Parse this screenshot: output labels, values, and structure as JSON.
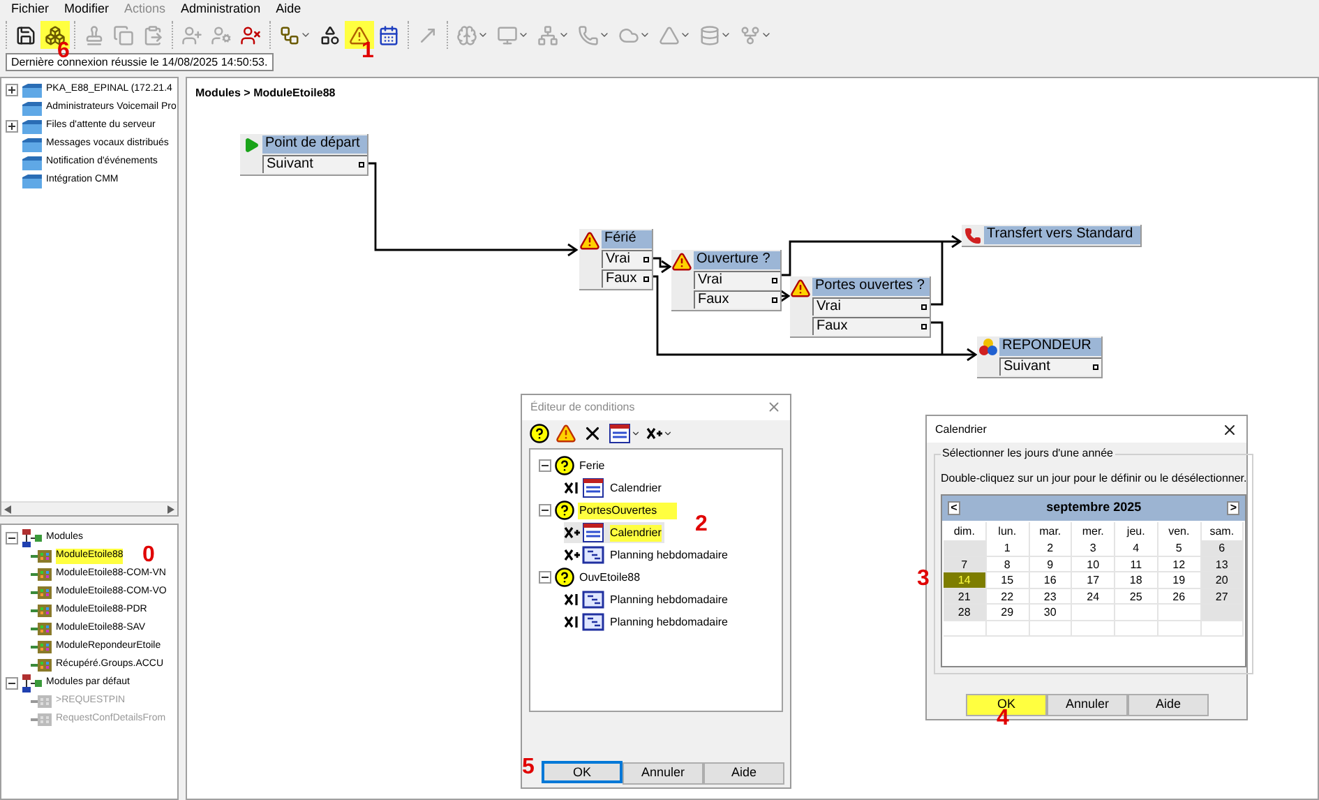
{
  "menu": [
    {
      "label": "Fichier",
      "disabled": false
    },
    {
      "label": "Modifier",
      "disabled": false
    },
    {
      "label": "Actions",
      "disabled": true
    },
    {
      "label": "Administration",
      "disabled": false
    },
    {
      "label": "Aide",
      "disabled": false
    }
  ],
  "toolbar": [
    [
      {
        "kind": "save",
        "disabled": false,
        "dropdown": false,
        "highlighted": false
      },
      {
        "kind": "module",
        "disabled": false,
        "dropdown": false,
        "highlighted": true,
        "annotation": "6"
      }
    ],
    [
      {
        "kind": "stamp",
        "disabled": true,
        "dropdown": false,
        "highlighted": false
      },
      {
        "kind": "copy",
        "disabled": true,
        "dropdown": false,
        "highlighted": false
      },
      {
        "kind": "paste",
        "disabled": true,
        "dropdown": false,
        "highlighted": false
      }
    ],
    [
      {
        "kind": "user-add",
        "disabled": true,
        "dropdown": false,
        "highlighted": false
      },
      {
        "kind": "user-help",
        "disabled": true,
        "dropdown": false,
        "highlighted": false
      },
      {
        "kind": "user-delete",
        "disabled": false,
        "dropdown": false,
        "highlighted": false
      }
    ],
    [
      {
        "kind": "connector",
        "disabled": false,
        "dropdown": true,
        "highlighted": false
      },
      {
        "kind": "shapes",
        "disabled": false,
        "dropdown": false,
        "highlighted": false
      },
      {
        "kind": "warning",
        "disabled": false,
        "dropdown": false,
        "highlighted": true,
        "annotation": "1"
      },
      {
        "kind": "calendar",
        "disabled": false,
        "dropdown": false,
        "highlighted": false
      }
    ],
    [
      {
        "kind": "line",
        "disabled": true,
        "dropdown": false,
        "highlighted": false
      }
    ],
    [
      {
        "kind": "brain",
        "disabled": true,
        "dropdown": true,
        "highlighted": false
      },
      {
        "kind": "monitor",
        "disabled": true,
        "dropdown": true,
        "highlighted": false
      },
      {
        "kind": "network",
        "disabled": true,
        "dropdown": true,
        "highlighted": false
      },
      {
        "kind": "phone",
        "disabled": true,
        "dropdown": true,
        "highlighted": false
      },
      {
        "kind": "cloud",
        "disabled": true,
        "dropdown": true,
        "highlighted": false
      },
      {
        "kind": "triangle",
        "disabled": true,
        "dropdown": true,
        "highlighted": false
      },
      {
        "kind": "disk",
        "disabled": true,
        "dropdown": true,
        "highlighted": false
      },
      {
        "kind": "fork",
        "disabled": true,
        "dropdown": true,
        "highlighted": false
      }
    ]
  ],
  "tooltip": "Dernière connexion réussie le 14/08/2025 14:50:53.",
  "server_tree": [
    {
      "label": "PKA_E88_EPINAL (172.21.4",
      "collapsed": true
    },
    {
      "label": "Administrateurs Voicemail Pro",
      "collapsed": false
    },
    {
      "label": "Files d'attente du serveur",
      "collapsed": true
    },
    {
      "label": "Messages vocaux distribués",
      "collapsed": false
    },
    {
      "label": "Notification d'événements",
      "collapsed": false
    },
    {
      "label": "Intégration CMM",
      "collapsed": false
    }
  ],
  "module_tree": [
    {
      "label": "Modules",
      "expanded": true,
      "children": [
        {
          "label": "ModuleEtoile88",
          "highlighted": true,
          "disabled": false,
          "annotation": "0"
        },
        {
          "label": "ModuleEtoile88-COM-VN",
          "highlighted": false,
          "disabled": false
        },
        {
          "label": "ModuleEtoile88-COM-VO",
          "highlighted": false,
          "disabled": false
        },
        {
          "label": "ModuleEtoile88-PDR",
          "highlighted": false,
          "disabled": false
        },
        {
          "label": "ModuleEtoile88-SAV",
          "highlighted": false,
          "disabled": false
        },
        {
          "label": "ModuleRepondeurEtoile",
          "highlighted": false,
          "disabled": false
        },
        {
          "label": "Récupéré.Groups.ACCU",
          "highlighted": false,
          "disabled": false
        }
      ]
    },
    {
      "label": "Modules par défaut",
      "expanded": true,
      "children": [
        {
          "label": ">REQUESTPIN",
          "highlighted": false,
          "disabled": true
        },
        {
          "label": "RequestConfDetailsFrom",
          "highlighted": false,
          "disabled": true
        }
      ]
    }
  ],
  "breadcrumb": "Modules > ModuleEtoile88",
  "nodes": [
    {
      "kind": "start",
      "title": "Point de départ",
      "outputs": [
        "Suivant"
      ]
    },
    {
      "kind": "condition",
      "title": "Férié",
      "outputs": [
        "Vrai",
        "Faux"
      ]
    },
    {
      "kind": "condition",
      "title": "Ouverture ?",
      "outputs": [
        "Vrai",
        "Faux"
      ]
    },
    {
      "kind": "condition",
      "title": "Portes ouvertes ?",
      "outputs": [
        "Vrai",
        "Faux"
      ]
    },
    {
      "kind": "transfer",
      "title": "Transfert vers Standard"
    },
    {
      "kind": "voicemail",
      "title": "REPONDEUR",
      "outputs": [
        "Suivant"
      ]
    }
  ],
  "condition_editor": {
    "title": "Éditeur de conditions",
    "tools": [
      {
        "kind": "new-condition",
        "dropdown": false
      },
      {
        "kind": "edit-warning",
        "dropdown": false
      },
      {
        "kind": "delete",
        "dropdown": false
      },
      {
        "kind": "calendar",
        "dropdown": true
      },
      {
        "kind": "operator",
        "dropdown": true
      }
    ],
    "conditions": [
      {
        "label": "Ferie",
        "highlighted": false,
        "children": [
          {
            "label": "Calendrier",
            "kind": "bar-calendar",
            "selected": false,
            "highlighted": false
          }
        ]
      },
      {
        "label": "PortesOuvertes",
        "highlighted": true,
        "children": [
          {
            "label": "Calendrier",
            "kind": "plus-calendar",
            "selected": true,
            "highlighted": true,
            "annotation": "2"
          },
          {
            "label": "Planning hebdomadaire",
            "kind": "plus-planning",
            "selected": false,
            "highlighted": false
          }
        ]
      },
      {
        "label": "OuvEtoile88",
        "highlighted": false,
        "children": [
          {
            "label": "Planning hebdomadaire",
            "kind": "bar-planning",
            "selected": false,
            "highlighted": false
          },
          {
            "label": "Planning hebdomadaire",
            "kind": "bar-planning",
            "selected": false,
            "highlighted": false
          }
        ]
      }
    ],
    "buttons": [
      {
        "label": "OK",
        "default": true,
        "highlighted": false,
        "annotation": "5"
      },
      {
        "label": "Annuler",
        "default": false,
        "highlighted": false
      },
      {
        "label": "Aide",
        "default": false,
        "highlighted": false
      }
    ]
  },
  "calendar_dialog": {
    "title": "Calendrier",
    "group_label": "Sélectionner les jours d'une année",
    "hint": "Double-cliquez sur un jour pour le définir ou le désélectionner.",
    "prev": "<",
    "next": ">",
    "month": "septembre 2025",
    "weekdays": [
      "dim.",
      "lun.",
      "mar.",
      "mer.",
      "jeu.",
      "ven.",
      "sam."
    ],
    "weeks": [
      [
        {
          "day": "1",
          "selected": false
        },
        {
          "day": "2",
          "selected": false
        },
        {
          "day": "3",
          "selected": false
        },
        {
          "day": "4",
          "selected": false
        },
        {
          "day": "5",
          "selected": false
        },
        {
          "day": "6",
          "selected": false
        }
      ],
      [
        {
          "day": "7",
          "selected": false
        },
        {
          "day": "8",
          "selected": false
        },
        {
          "day": "9",
          "selected": false
        },
        {
          "day": "10",
          "selected": false
        },
        {
          "day": "11",
          "selected": false
        },
        {
          "day": "12",
          "selected": false
        },
        {
          "day": "13",
          "selected": false
        }
      ],
      [
        {
          "day": "14",
          "selected": true,
          "annotation": "3"
        },
        {
          "day": "15",
          "selected": false
        },
        {
          "day": "16",
          "selected": false
        },
        {
          "day": "17",
          "selected": false
        },
        {
          "day": "18",
          "selected": false
        },
        {
          "day": "19",
          "selected": false
        },
        {
          "day": "20",
          "selected": false
        }
      ],
      [
        {
          "day": "21",
          "selected": false
        },
        {
          "day": "22",
          "selected": false
        },
        {
          "day": "23",
          "selected": false
        },
        {
          "day": "24",
          "selected": false
        },
        {
          "day": "25",
          "selected": false
        },
        {
          "day": "26",
          "selected": false
        },
        {
          "day": "27",
          "selected": false
        }
      ],
      [
        {
          "day": "28",
          "selected": false
        },
        {
          "day": "29",
          "selected": false
        },
        {
          "day": "30",
          "selected": false
        }
      ]
    ],
    "buttons": [
      {
        "label": "OK",
        "default": false,
        "highlighted": true,
        "annotation": "4"
      },
      {
        "label": "Annuler",
        "default": false,
        "highlighted": false
      },
      {
        "label": "Aide",
        "default": false,
        "highlighted": false
      }
    ]
  }
}
